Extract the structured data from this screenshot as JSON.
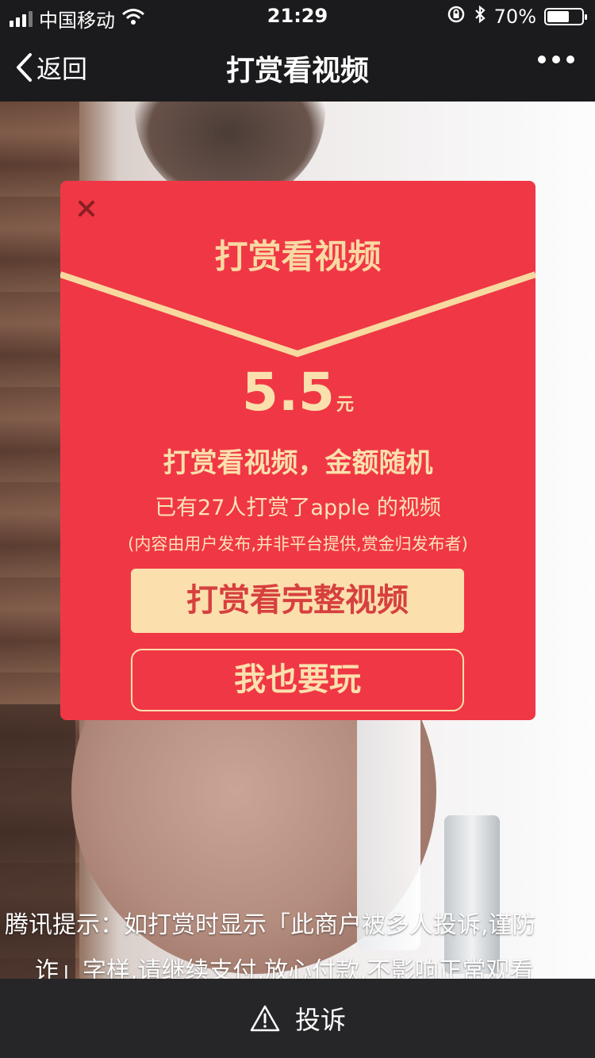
{
  "status_bar": {
    "carrier": "中国移动",
    "time": "21:29",
    "battery_percent": "70%",
    "battery_level": 0.7,
    "icons": [
      "signal-icon",
      "wifi-icon",
      "rotation-lock-icon",
      "bluetooth-icon",
      "battery-icon"
    ]
  },
  "nav": {
    "back_label": "返回",
    "title": "打赏看视频",
    "more_icon": "more-dots-icon"
  },
  "modal": {
    "close_icon": "close-icon",
    "title": "打赏看视频",
    "amount": "5.5",
    "amount_unit": "元",
    "subtitle": "打赏看视频，金额随机",
    "count_text": "已有27人打赏了apple 的视频",
    "disclaimer": "(内容由用户发布,并非平台提供,赏金归发布者)",
    "primary_button": "打赏看完整视频",
    "secondary_button": "我也要玩",
    "colors": {
      "background": "#f03745",
      "gold": "#fae0ac",
      "primary_button_bg": "#fbe0ad",
      "primary_button_text": "#d7403f"
    }
  },
  "notice": {
    "line1": "腾讯提示：如打赏时显示「此商户被多人投诉,谨防",
    "line2": "诈」字样,请继续支付,放心付款,不影响正常观看"
  },
  "bottom_bar": {
    "report_label": "投诉",
    "icon": "warning-icon"
  }
}
